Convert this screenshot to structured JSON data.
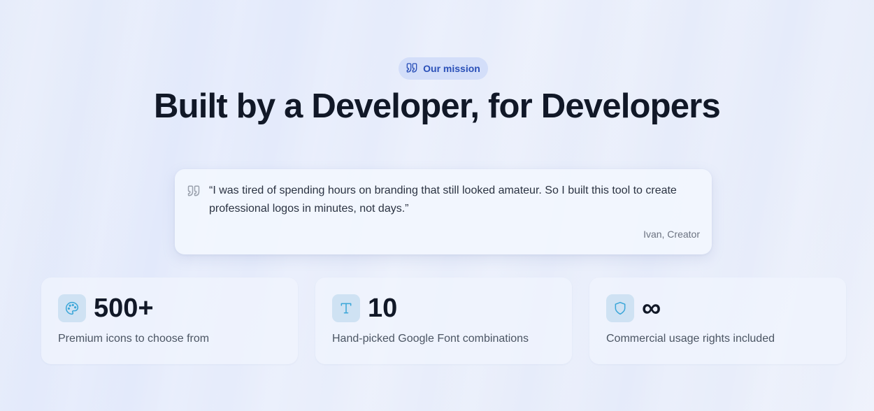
{
  "badge": {
    "icon": "quote-icon",
    "label": "Our mission"
  },
  "heading": "Built by a Developer, for Developers",
  "quote": {
    "icon": "quote-icon",
    "text": "“I was tired of spending hours on branding that still looked amateur. So I built this tool to create professional logos in minutes, not days.”",
    "author": "Ivan, Creator"
  },
  "stats": [
    {
      "icon": "palette-icon",
      "value": "500+",
      "label": "Premium icons to choose from"
    },
    {
      "icon": "type-icon",
      "value": "10",
      "label": "Hand-picked Google Font combinations"
    },
    {
      "icon": "shield-icon",
      "value": "∞",
      "label": "Commercial usage rights included"
    }
  ],
  "colors": {
    "accent": "#2a50b8",
    "icon_accent": "#3aa6d8",
    "heading": "#111827"
  }
}
